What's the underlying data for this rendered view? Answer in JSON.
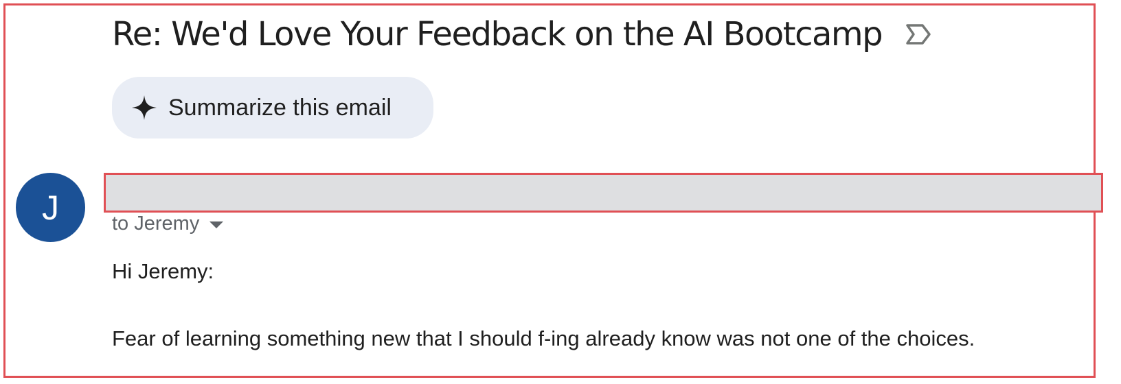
{
  "email": {
    "subject": "Re: We'd Love Your Feedback on the AI Bootcamp",
    "important_icon": "label-important-outline-icon",
    "summarize": {
      "label": "Summarize this email",
      "icon": "sparkle-icon"
    },
    "sender": {
      "avatar_initial": "J",
      "avatar_color": "#1b5196",
      "name_redacted": true
    },
    "recipient_line": "to Jeremy",
    "body": {
      "greeting": "Hi Jeremy:",
      "paragraph": "Fear of learning something new that I should f-ing already know was not one of the choices."
    }
  },
  "colors": {
    "highlight_border": "#e05055",
    "summarize_bg": "#e9edf5",
    "redaction_fill": "#dedfe1",
    "text_primary": "#1f1f1f",
    "text_secondary": "#5f6368"
  }
}
